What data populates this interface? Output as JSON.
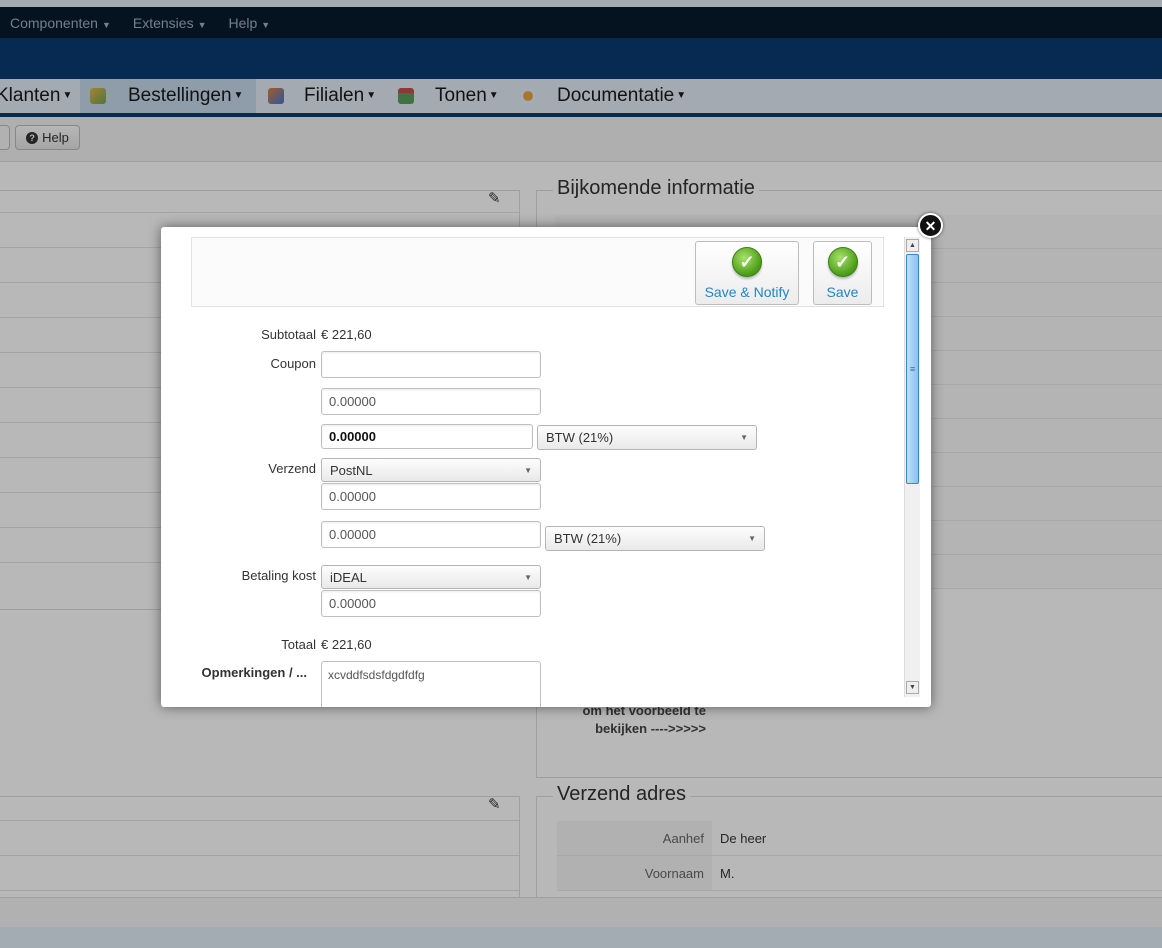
{
  "admin_menu": [
    {
      "label": "Componenten"
    },
    {
      "label": "Extensies"
    },
    {
      "label": "Help"
    }
  ],
  "component_nav": [
    {
      "label": "Klanten"
    },
    {
      "label": "Bestellingen"
    },
    {
      "label": "Filialen"
    },
    {
      "label": "Tonen"
    },
    {
      "label": "Documentatie"
    }
  ],
  "toolbar": {
    "help_label": "Help"
  },
  "background": {
    "right_section_title": "Bijkomende informatie",
    "preview_text_line1": "om het voorbeeld te",
    "preview_text_line2": "bekijken ---->>>>>",
    "address_title": "Verzend adres",
    "address_rows": [
      {
        "label": "Aanhef",
        "value": "De heer"
      },
      {
        "label": "Voornaam",
        "value": "M."
      }
    ]
  },
  "modal": {
    "save_notify_label": "Save & Notify",
    "save_label": "Save",
    "subtotal_label": "Subtotaal",
    "subtotal_value": "€ 221,60",
    "coupon_label": "Coupon",
    "coupon_value": "",
    "discount_value": "0.00000",
    "discount_tax_value": "0.00000",
    "discount_tax_rate": "BTW (21%)",
    "shipping_label": "Verzend",
    "shipping_method": "PostNL",
    "shipping_value": "0.00000",
    "shipping_tax_value": "0.00000",
    "shipping_tax_rate": "BTW (21%)",
    "payment_label": "Betaling kost",
    "payment_method": "iDEAL",
    "payment_value": "0.00000",
    "total_label": "Totaal",
    "total_value": "€ 221,60",
    "remarks_label": "Opmerkingen / ...",
    "remarks_value": "xcvddfsdsfdgdfdfg"
  }
}
